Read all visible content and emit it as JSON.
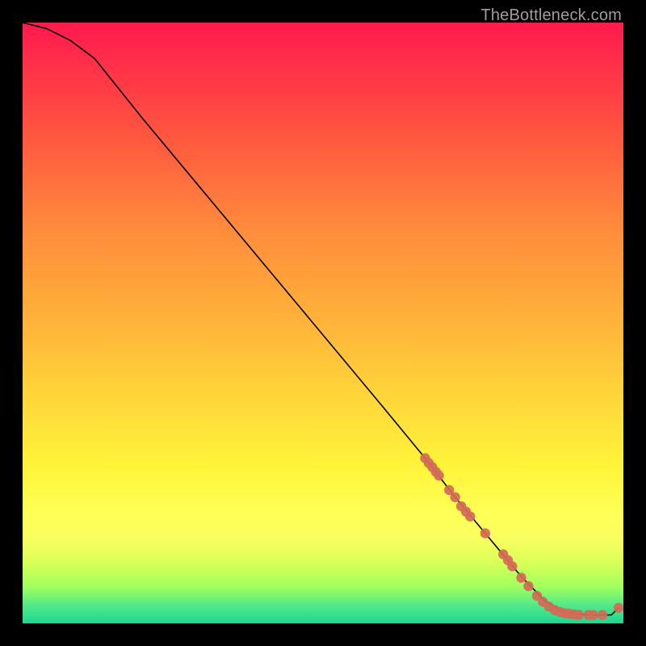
{
  "attribution": "TheBottleneck.com",
  "chart_data": {
    "type": "line",
    "title": "",
    "xlabel": "",
    "ylabel": "",
    "xlim": [
      0,
      100
    ],
    "ylim": [
      0,
      100
    ],
    "grid": false,
    "legend": false,
    "curve": {
      "name": "bottleneck-curve",
      "x": [
        0,
        4,
        8,
        12,
        20,
        30,
        40,
        50,
        60,
        67,
        72,
        77,
        83,
        87,
        90,
        92,
        94,
        96,
        98,
        99.2
      ],
      "y": [
        100,
        99,
        97,
        94,
        84,
        72,
        60,
        48,
        36,
        27.5,
        21,
        15,
        7.8,
        3.7,
        2.0,
        1.6,
        1.4,
        1.4,
        1.4,
        2.6
      ]
    },
    "dot_series": {
      "name": "sample-points",
      "color": "#d46a57",
      "points": [
        {
          "x": 67.0,
          "y": 27.5
        },
        {
          "x": 67.6,
          "y": 26.7
        },
        {
          "x": 68.2,
          "y": 26.0
        },
        {
          "x": 68.8,
          "y": 25.2
        },
        {
          "x": 69.3,
          "y": 24.6
        },
        {
          "x": 71.0,
          "y": 22.2
        },
        {
          "x": 72.0,
          "y": 21.0
        },
        {
          "x": 73.0,
          "y": 19.5
        },
        {
          "x": 73.8,
          "y": 18.6
        },
        {
          "x": 74.5,
          "y": 17.8
        },
        {
          "x": 77.0,
          "y": 15.0
        },
        {
          "x": 80.0,
          "y": 11.5
        },
        {
          "x": 80.8,
          "y": 10.5
        },
        {
          "x": 81.5,
          "y": 9.5
        },
        {
          "x": 83.0,
          "y": 7.6
        },
        {
          "x": 84.2,
          "y": 6.2
        },
        {
          "x": 85.6,
          "y": 4.6
        },
        {
          "x": 86.6,
          "y": 3.6
        },
        {
          "x": 87.6,
          "y": 2.8
        },
        {
          "x": 88.6,
          "y": 2.2
        },
        {
          "x": 89.4,
          "y": 1.9
        },
        {
          "x": 90.2,
          "y": 1.7
        },
        {
          "x": 91.0,
          "y": 1.6
        },
        {
          "x": 91.8,
          "y": 1.5
        },
        {
          "x": 92.6,
          "y": 1.4
        },
        {
          "x": 94.2,
          "y": 1.4
        },
        {
          "x": 95.0,
          "y": 1.4
        },
        {
          "x": 96.5,
          "y": 1.4
        },
        {
          "x": 99.2,
          "y": 2.6
        }
      ]
    }
  }
}
